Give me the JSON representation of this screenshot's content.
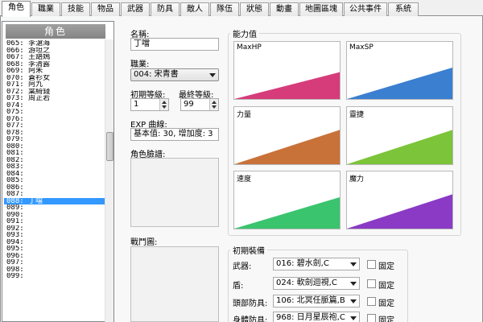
{
  "tabs": [
    "角色",
    "職業",
    "技能",
    "物品",
    "武器",
    "防具",
    "敵人",
    "隊伍",
    "狀態",
    "動畫",
    "地圖區塊",
    "公共事件",
    "系統"
  ],
  "list": {
    "header": "角色",
    "items": [
      "065: 李滄海",
      "066: 游坦之",
      "067: 王語嫣",
      "068: 李清露",
      "069: 阿朱",
      "070: 蒼衫女",
      "071: 阿九",
      "072: 葉綺錢",
      "073: 周芷若",
      "074:",
      "075:",
      "076:",
      "077:",
      "078:",
      "079:",
      "080:",
      "081:",
      "082:",
      "083:",
      "084:",
      "085:",
      "086:",
      "087:",
      "088: 丁噹",
      "089:",
      "090:",
      "091:",
      "092:",
      "093:",
      "094:",
      "095:",
      "096:",
      "097:",
      "098:",
      "099:"
    ],
    "selected_index": 23
  },
  "form": {
    "name_label": "名稱:",
    "name_value": "丁噹",
    "class_label": "職業:",
    "class_value": "004: 宋青書",
    "init_level_label": "初期等級:",
    "init_level_value": "1",
    "final_level_label": "最終等級:",
    "final_level_value": "99",
    "exp_label": "EXP 曲線:",
    "exp_value": "基本值: 30, 增加度: 3",
    "face_label": "角色臉譜:",
    "battler_label": "戰鬥圖:"
  },
  "stats": {
    "title": "能力值",
    "items": [
      {
        "name": "MaxHP",
        "color": "#d63c7a",
        "level": 0.47
      },
      {
        "name": "MaxSP",
        "color": "#3a7fd0",
        "level": 0.55
      },
      {
        "name": "力量",
        "color": "#c8723a",
        "level": 0.6
      },
      {
        "name": "靈捷",
        "color": "#7cc43a",
        "level": 0.6
      },
      {
        "name": "速度",
        "color": "#3ac46e",
        "level": 0.55
      },
      {
        "name": "魔力",
        "color": "#8a3ac4",
        "level": 0.6
      }
    ]
  },
  "equipment": {
    "title": "初期裝備",
    "fixed_label": "固定",
    "rows": [
      {
        "label": "武器:",
        "value": "016: 碧水劍,C"
      },
      {
        "label": "盾:",
        "value": "024: 軟劍迴視,C"
      },
      {
        "label": "頭部防具:",
        "value": "106: 北冥任脈篇,B"
      },
      {
        "label": "身體防具:",
        "value": "968: 日月星辰袍,C"
      }
    ]
  }
}
